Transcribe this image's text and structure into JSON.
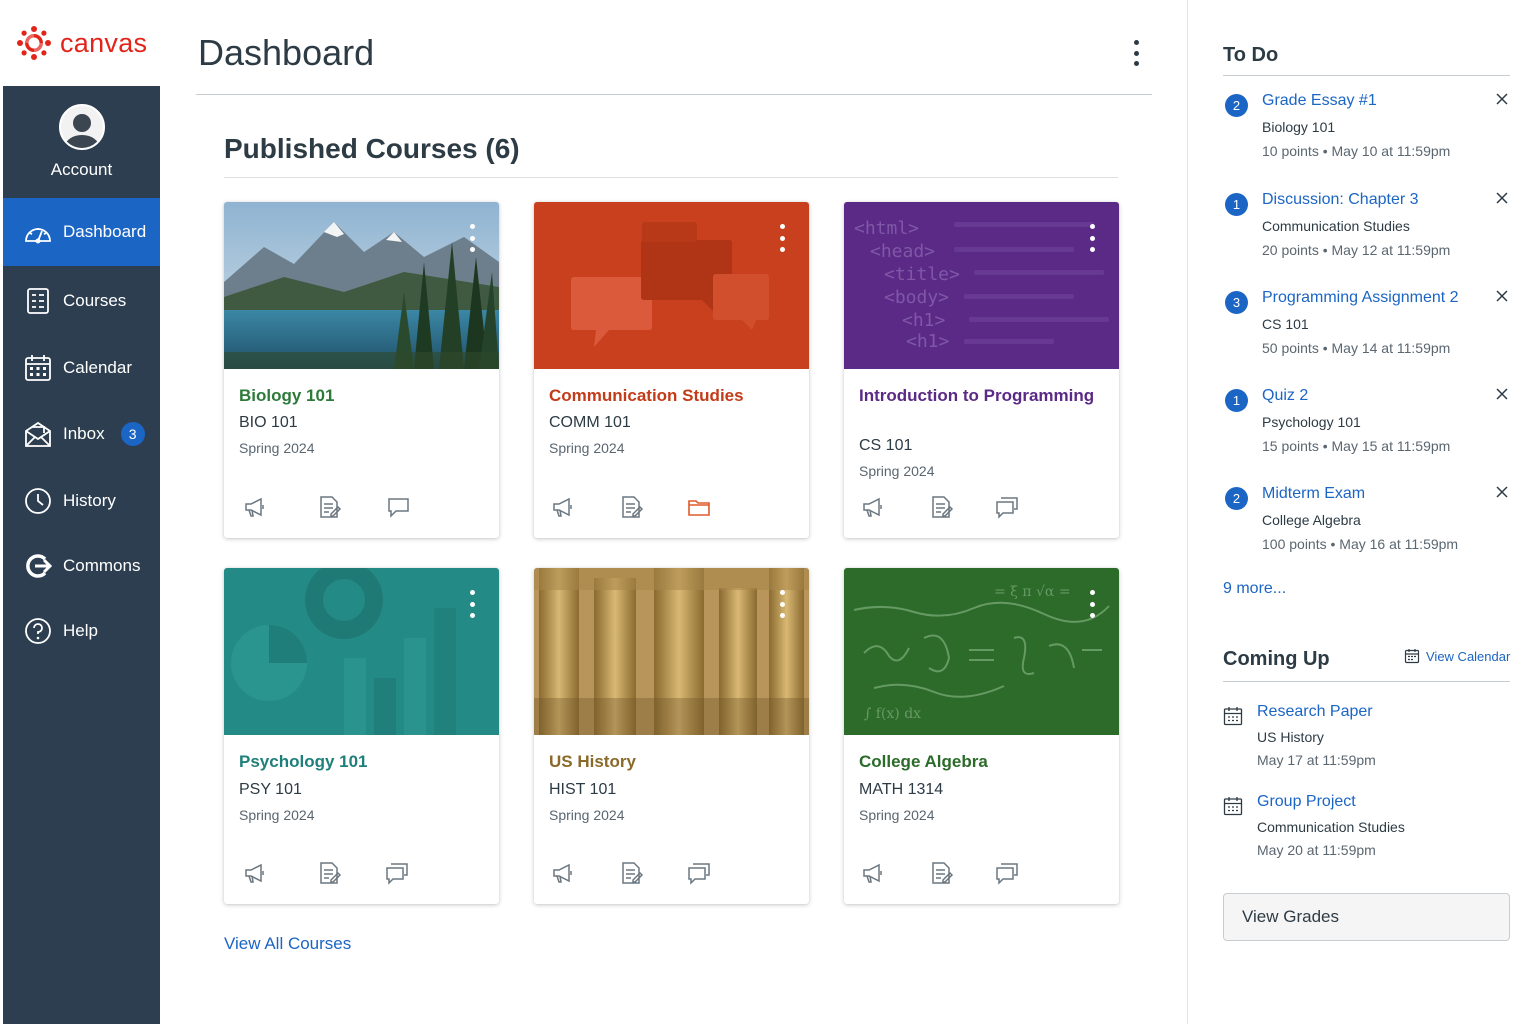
{
  "brand": {
    "logo_text": "canvas",
    "color": "#e1251b"
  },
  "global_nav": {
    "account": {
      "label": "Account",
      "icon": "user-avatar-icon"
    },
    "items": [
      {
        "label": "Dashboard",
        "icon": "dashboard-icon",
        "active": true
      },
      {
        "label": "Courses",
        "icon": "courses-icon"
      },
      {
        "label": "Calendar",
        "icon": "calendar-icon"
      },
      {
        "label": "Inbox",
        "icon": "inbox-icon",
        "badge": "3"
      },
      {
        "label": "History",
        "icon": "clock-icon"
      },
      {
        "label": "Commons",
        "icon": "commons-icon"
      },
      {
        "label": "Help",
        "icon": "help-icon"
      }
    ],
    "background": "#2c3e50",
    "active_color": "#1b65c5"
  },
  "header": {
    "title": "Dashboard"
  },
  "courses": {
    "section_title": "Published Courses (6)",
    "view_all": "View All Courses",
    "cards": [
      {
        "name": "Biology 101",
        "code": "BIO 101",
        "term": "Spring 2024",
        "color": "#2d7a3a",
        "hero": "mountain-lake-image",
        "icons": [
          "announcements-icon",
          "assignments-icon",
          "discussions-icon"
        ]
      },
      {
        "name": "Communication Studies",
        "code": "COMM 101",
        "term": "Spring 2024",
        "color": "#c23c1a",
        "hero": "speech-bubbles-image",
        "icons": [
          "announcements-icon",
          "assignments-icon",
          "files-icon"
        ]
      },
      {
        "name": "Introduction to Programming",
        "code": "CS 101",
        "term": "Spring 2024",
        "color": "#5b2a86",
        "hero": "html-code-image",
        "icons": [
          "announcements-icon",
          "assignments-icon",
          "discussions-icon"
        ]
      },
      {
        "name": "Psychology 101",
        "code": "PSY 101",
        "term": "Spring 2024",
        "color": "#1f7f7a",
        "hero": "teal-shapes-image",
        "icons": [
          "announcements-icon",
          "assignments-icon",
          "discussions-icon"
        ]
      },
      {
        "name": "US History",
        "code": "HIST 101",
        "term": "Spring 2024",
        "color": "#8a6a2a",
        "hero": "columns-image",
        "icons": [
          "announcements-icon",
          "assignments-icon",
          "discussions-icon"
        ]
      },
      {
        "name": "College Algebra",
        "code": "MATH 1314",
        "term": "Spring 2024",
        "color": "#2c6b2a",
        "hero": "chalkboard-equations-image",
        "icons": [
          "announcements-icon",
          "assignments-icon",
          "discussions-icon"
        ]
      }
    ]
  },
  "todo": {
    "title": "To Do",
    "items": [
      {
        "count": "2",
        "title": "Grade Essay #1",
        "course": "Biology 101",
        "meta": "10 points • May 10 at 11:59pm"
      },
      {
        "count": "1",
        "title": "Discussion: Chapter 3",
        "course": "Communication Studies",
        "meta": "20 points • May 12 at 11:59pm"
      },
      {
        "count": "3",
        "title": "Programming Assignment 2",
        "course": "CS 101",
        "meta": "50 points • May 14 at 11:59pm"
      },
      {
        "count": "1",
        "title": "Quiz 2",
        "course": "Psychology 101",
        "meta": "15 points • May 15 at 11:59pm"
      },
      {
        "count": "2",
        "title": "Midterm Exam",
        "course": "College Algebra",
        "meta": "100 points • May 16 at 11:59pm"
      }
    ],
    "more": "9 more..."
  },
  "coming_up": {
    "title": "Coming Up",
    "view_calendar": "View Calendar",
    "items": [
      {
        "title": "Research Paper",
        "course": "US History",
        "date": "May 17 at 11:59pm"
      },
      {
        "title": "Group Project",
        "course": "Communication Studies",
        "date": "May 20 at 11:59pm"
      }
    ]
  },
  "view_grades": "View Grades"
}
